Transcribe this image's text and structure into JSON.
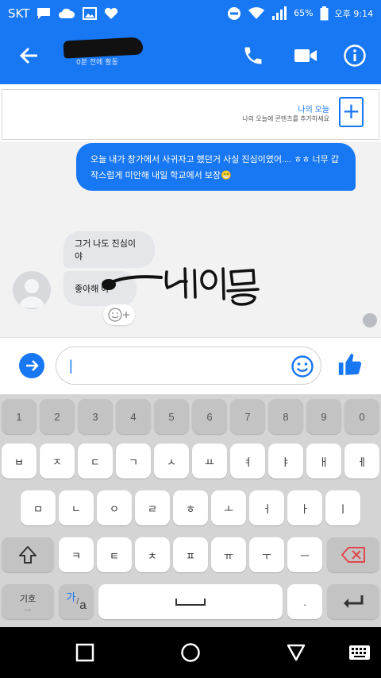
{
  "status_bar": {
    "carrier": "SKT",
    "battery": "65%",
    "time": "오후 9:14",
    "icons": [
      "message-icon",
      "cloud-icon",
      "image-icon",
      "heart-icon",
      "do-not-disturb-icon",
      "wifi-icon",
      "signal-icon",
      "battery-icon"
    ]
  },
  "header": {
    "contact_status": "0분 전에 활동",
    "icons": {
      "back": "arrow-left-icon",
      "call": "phone-icon",
      "video": "video-camera-icon",
      "info": "info-icon"
    }
  },
  "story": {
    "title": "나의 오늘",
    "subtitle": "나의 오늘에 콘텐츠를 추가하세요",
    "add_symbol": "+"
  },
  "messages": {
    "outgoing": "오늘 내가 창가에서 사귀자고 했던거 사실 진심이였어.... ㅎㅎ 너무 갑작스럽게 미안해 내일 학교에서 보장😁",
    "incoming": [
      "그거 나도 진심이야",
      "좋아해 아"
    ]
  },
  "composer": {
    "value": "|",
    "icons": {
      "send": "arrow-right-icon",
      "emoji": "smiley-icon",
      "like": "thumbs-up-icon"
    }
  },
  "keyboard": {
    "row_numbers": [
      "1",
      "2",
      "3",
      "4",
      "5",
      "6",
      "7",
      "8",
      "9",
      "0"
    ],
    "row1": [
      "ㅂ",
      "ㅈ",
      "ㄷ",
      "ㄱ",
      "ㅅ",
      "ㅛ",
      "ㅕ",
      "ㅑ",
      "ㅐ",
      "ㅔ"
    ],
    "row2": [
      "ㅁ",
      "ㄴ",
      "ㅇ",
      "ㄹ",
      "ㅎ",
      "ㅗ",
      "ㅓ",
      "ㅏ",
      "ㅣ"
    ],
    "row3": [
      "ㅋ",
      "ㅌ",
      "ㅊ",
      "ㅍ",
      "ㅠ",
      "ㅜ",
      "ㅡ"
    ],
    "symbol_key": "기호",
    "lang_key_top": "가",
    "lang_key_bottom": "a",
    "period_key": ".",
    "icons": {
      "shift": "shift-icon",
      "backspace": "backspace-icon",
      "space": "space-icon",
      "enter": "enter-icon"
    }
  },
  "navbar": {
    "icons": {
      "recent": "square-icon",
      "home": "circle-icon",
      "back": "triangle-back-icon",
      "keyboard": "keyboard-icon"
    }
  },
  "colors": {
    "accent": "#1877f2",
    "bubble_in": "#e4e6ea",
    "delete_red": "#e0474c"
  }
}
